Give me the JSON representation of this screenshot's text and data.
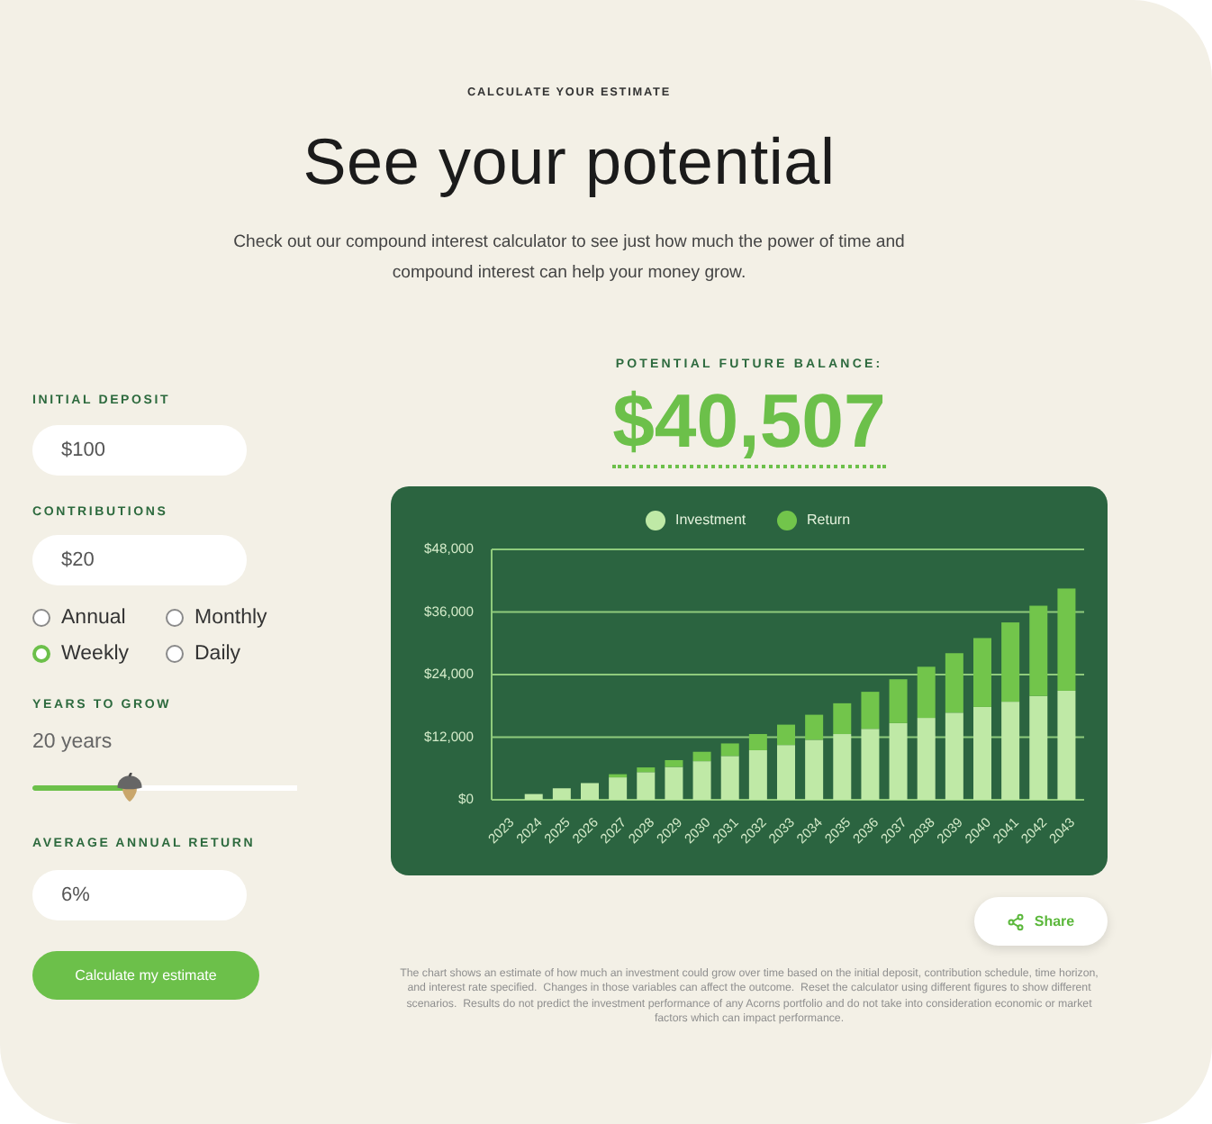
{
  "header": {
    "eyebrow": "CALCULATE YOUR ESTIMATE",
    "title": "See your potential",
    "intro": "Check out our compound interest calculator to see just how much the power of time and compound interest can help your money grow."
  },
  "inputs": {
    "initial_deposit": {
      "label": "INITIAL DEPOSIT",
      "value": "$100"
    },
    "contributions": {
      "label": "CONTRIBUTIONS",
      "value": "$20",
      "frequencies": [
        {
          "label": "Annual",
          "selected": false
        },
        {
          "label": "Monthly",
          "selected": false
        },
        {
          "label": "Weekly",
          "selected": true
        },
        {
          "label": "Daily",
          "selected": false
        }
      ]
    },
    "years_to_grow": {
      "label": "YEARS TO GROW",
      "reading": "20 years",
      "level": 0.37
    },
    "average_annual_return": {
      "label": "AVERAGE ANNUAL RETURN",
      "value": "6%"
    },
    "calculate_button": "Calculate my estimate"
  },
  "result": {
    "label": "POTENTIAL FUTURE BALANCE:",
    "amount": "$40,507",
    "chart_data": {
      "type": "bar",
      "stacked": true,
      "grid": true,
      "legend": "top",
      "categories": [
        "2023",
        "2024",
        "2025",
        "2026",
        "2027",
        "2028",
        "2029",
        "2030",
        "2031",
        "2032",
        "2033",
        "2034",
        "2035",
        "2036",
        "2037",
        "2038",
        "2039",
        "2040",
        "2041",
        "2042",
        "2043"
      ],
      "series": [
        {
          "name": "Investment",
          "color": "#bfe9a6",
          "values": [
            100,
            1100,
            2200,
            3200,
            4300,
            5300,
            6300,
            7400,
            8400,
            9500,
            10500,
            11500,
            12600,
            13600,
            14700,
            15700,
            16700,
            17800,
            18800,
            19900,
            20900
          ]
        },
        {
          "name": "Return",
          "color": "#72c54b",
          "values": [
            0,
            0,
            100,
            300,
            600,
            900,
            1300,
            1800,
            2400,
            3100,
            3900,
            4800,
            5900,
            7100,
            8400,
            9800,
            11400,
            13200,
            15200,
            17300,
            19600
          ]
        }
      ],
      "ylim": [
        0,
        48000
      ],
      "yticks": [
        {
          "value": 0,
          "label": "$0"
        },
        {
          "value": 12000,
          "label": "$12,000"
        },
        {
          "value": 24000,
          "label": "$24,000"
        },
        {
          "value": 36000,
          "label": "$36,000"
        },
        {
          "value": 48000,
          "label": "$48,000"
        }
      ]
    },
    "share_button": "Share",
    "disclaimer": "The chart shows an estimate of how much an investment could grow over time based on the initial deposit, contribution schedule, time horizon, and interest rate specified.  Changes in those variables can affect the outcome.  Reset the calculator using different figures to show different scenarios.  Results do not predict the investment performance of any Acorns portfolio and do not take into consideration economic or market factors which can impact performance."
  }
}
